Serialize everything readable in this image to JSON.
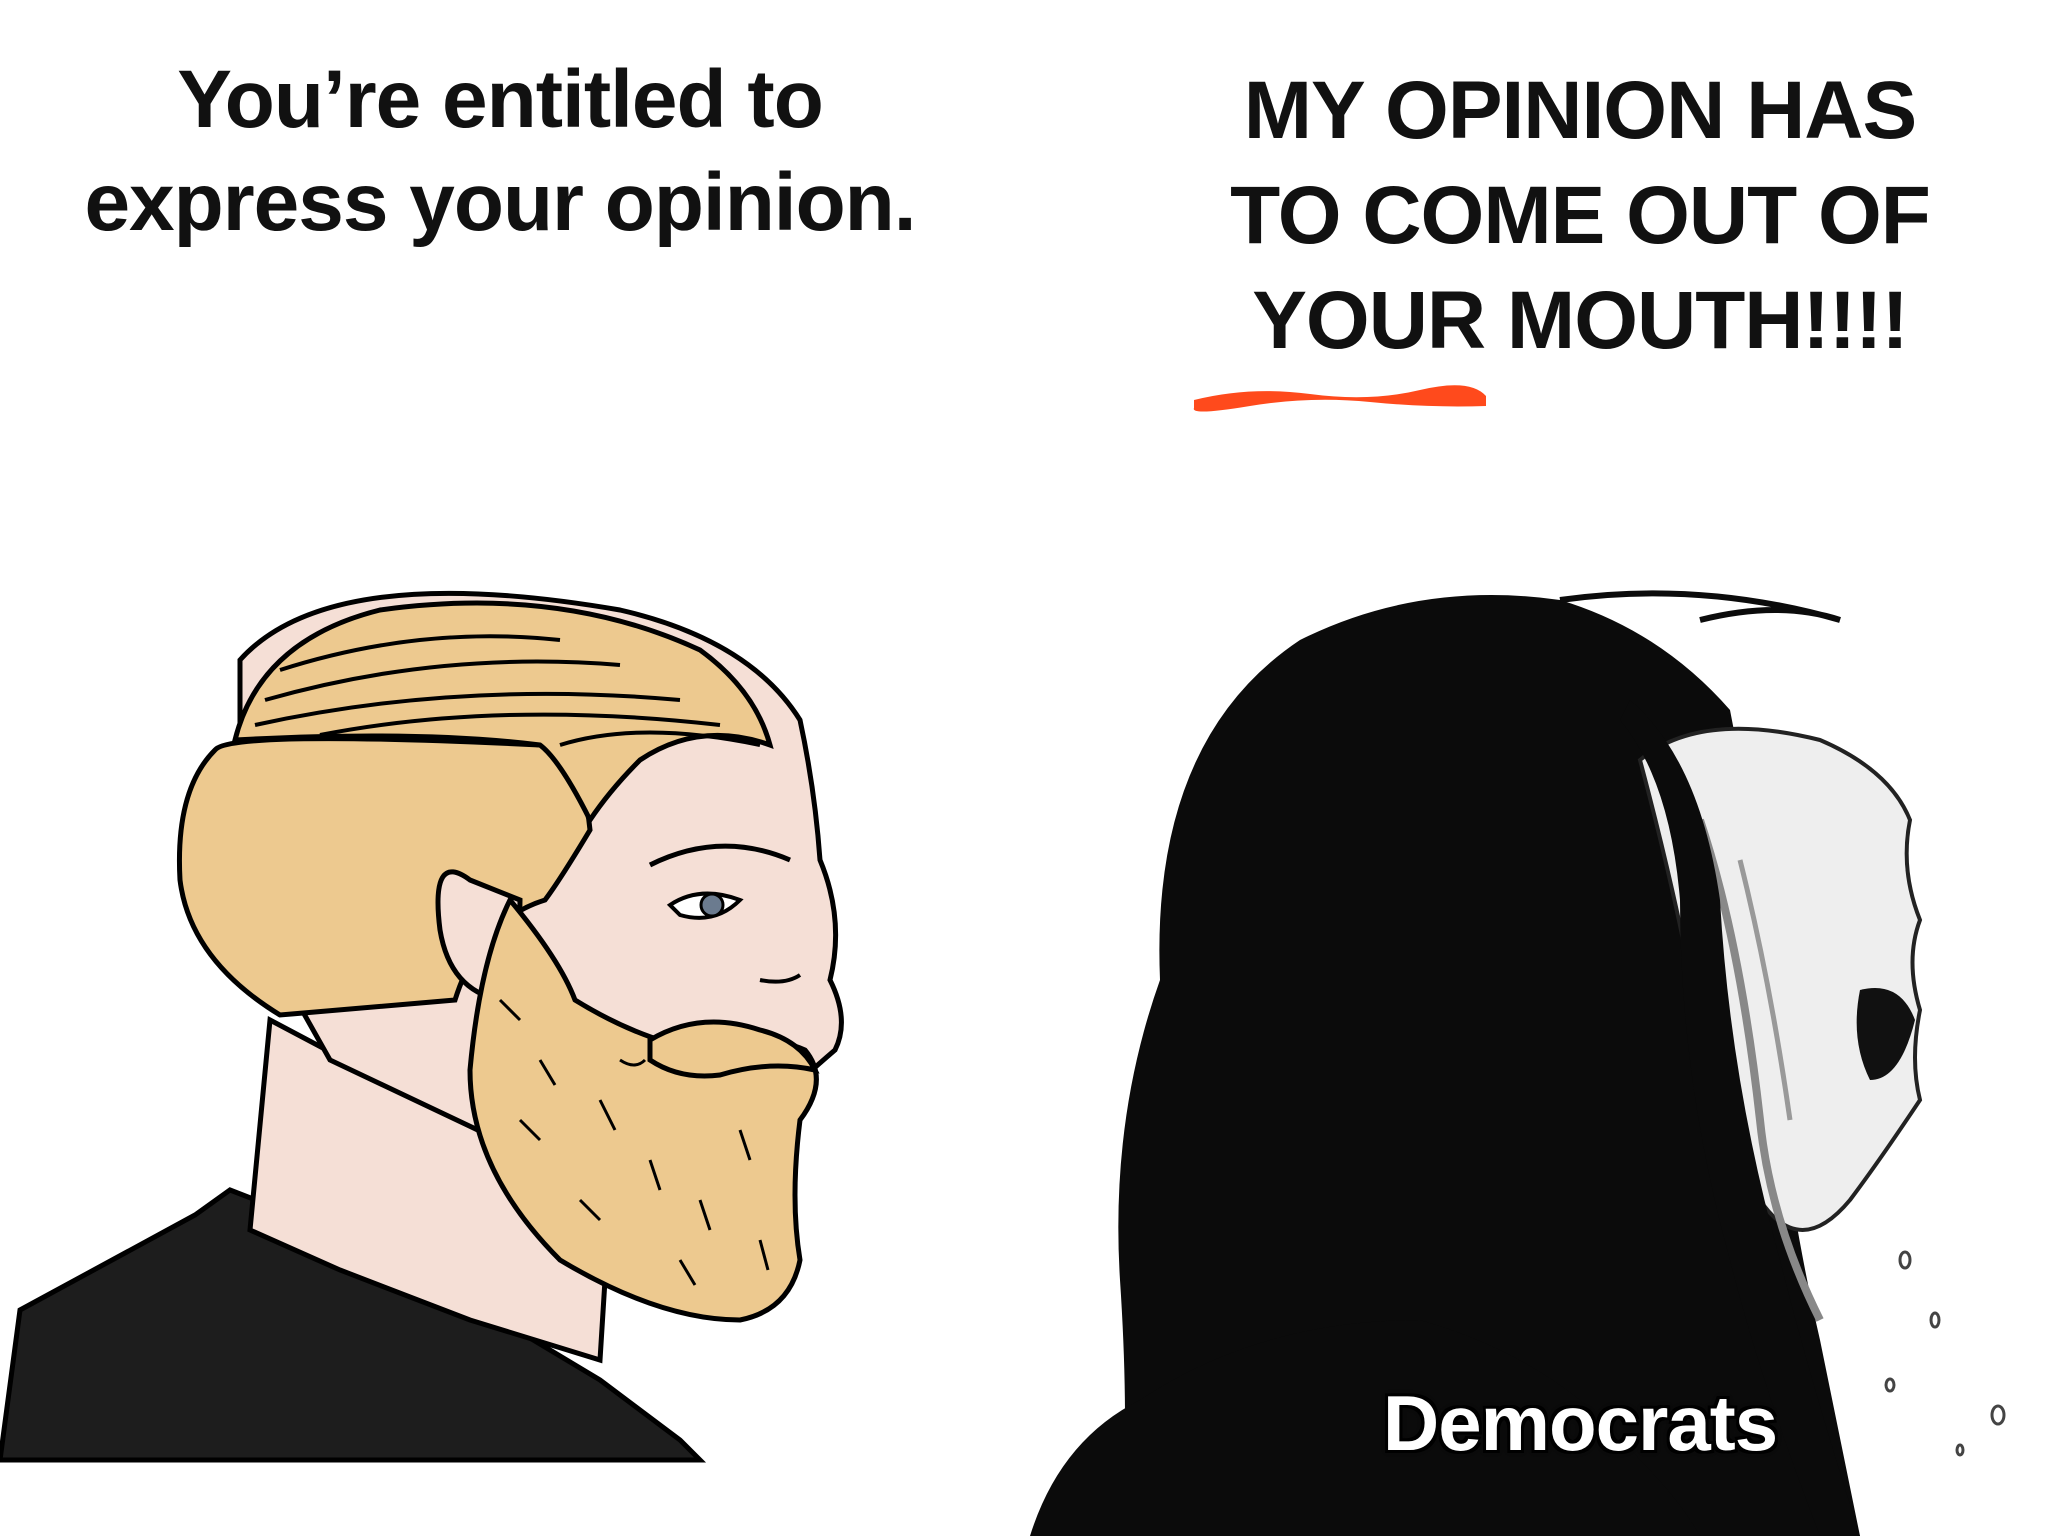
{
  "panels": {
    "left": {
      "caption": "You’re entitled to\nexpress your opinion.",
      "figure_icon": "bearded-blond-man-profile"
    },
    "right": {
      "caption": "MY OPINION HAS\nTO COME OUT OF\nYOUR MOUTH!!!!",
      "figure_icon": "crying-screaming-woman-profile",
      "label": "Democrats"
    }
  },
  "colors": {
    "background": "#ffffff",
    "text": "#111111",
    "underline": "#ff4a1c",
    "hair_blond": "#edc98f",
    "skin": "#f5dfd6",
    "shirt": "#1d1d1d",
    "woman_hair": "#0b0b0b"
  }
}
